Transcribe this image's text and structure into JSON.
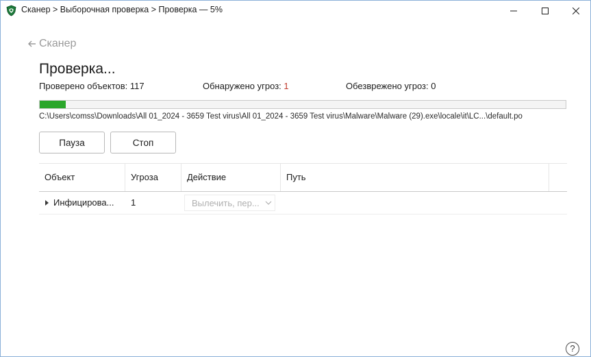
{
  "window": {
    "title": "Сканер > Выборочная проверка > Проверка — 5%",
    "app_icon": "kaspersky-shield-icon"
  },
  "nav": {
    "back_label": "Сканер"
  },
  "page": {
    "title": "Проверка..."
  },
  "stats": {
    "checked_label": "Проверено объектов:",
    "checked_value": "117",
    "found_label": "Обнаружено угроз:",
    "found_value": "1",
    "neutralized_label": "Обезврежено угроз:",
    "neutralized_value": "0"
  },
  "progress": {
    "percent": 5,
    "fill_color": "#2aa62a",
    "current_path": "C:\\Users\\comss\\Downloads\\All 01_2024 - 3659 Test virus\\All 01_2024 - 3659 Test virus\\Malware\\Malware  (29).exe\\locale\\it\\LC...\\default.po"
  },
  "buttons": {
    "pause_label": "Пауза",
    "stop_label": "Стоп"
  },
  "table": {
    "columns": [
      "Объект",
      "Угроза",
      "Действие",
      "Путь"
    ],
    "rows": [
      {
        "object": "Инфицирова...",
        "threat": "1",
        "action": "Вылечить, пер...",
        "path": ""
      }
    ]
  },
  "help": {
    "label": "?"
  }
}
